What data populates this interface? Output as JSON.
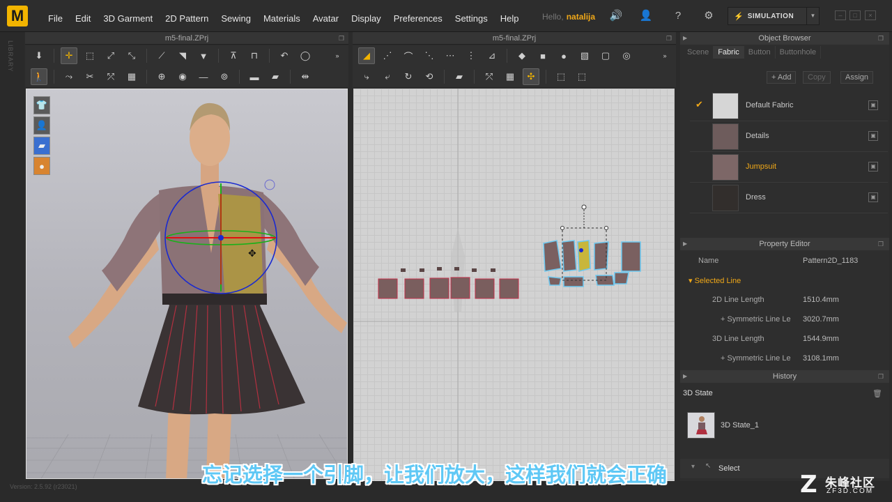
{
  "app": {
    "logo_letter": "M",
    "menus": [
      "File",
      "Edit",
      "3D Garment",
      "2D Pattern",
      "Sewing",
      "Materials",
      "Avatar",
      "Display",
      "Preferences",
      "Settings",
      "Help"
    ],
    "greeting": "Hello,",
    "username": "natalija",
    "simulation_label": "SIMULATION",
    "library_label": "LIBRARY",
    "accent_color": "#f0a818"
  },
  "view3d": {
    "title": "m5-final.ZPrj"
  },
  "view2d": {
    "title": "m5-final.ZPrj"
  },
  "object_browser": {
    "title": "Object Browser",
    "tabs": [
      "Scene",
      "Fabric",
      "Button",
      "Buttonhole"
    ],
    "selected_tab": "Fabric",
    "buttons": {
      "add": "+ Add",
      "copy": "Copy",
      "assign": "Assign"
    },
    "fabrics": [
      {
        "name": "Default Fabric",
        "color": "#d6d6d6",
        "checked": true
      },
      {
        "name": "Details",
        "color": "#6e5c5c",
        "checked": false
      },
      {
        "name": "Jumpsuit",
        "color": "#7d6767",
        "checked": false
      },
      {
        "name": "Dress",
        "color": "#322e2c",
        "checked": false
      }
    ]
  },
  "property_editor": {
    "title": "Property Editor",
    "name_label": "Name",
    "name_value": "Pattern2D_1183",
    "section": "Selected Line",
    "rows": [
      {
        "label": "2D Line Length",
        "value": "1510.4mm"
      },
      {
        "label": "+ Symmetric Line Le",
        "value": "3020.7mm"
      },
      {
        "label": "3D Line Length",
        "value": "1544.9mm"
      },
      {
        "label": "+ Symmetric Line Le",
        "value": "3108.1mm"
      }
    ]
  },
  "history": {
    "title": "History",
    "state_header": "3D State",
    "item": "3D State_1",
    "select_label": "Select"
  },
  "status": {
    "version": "Version: 2.5.92   (r23021)"
  },
  "subtitle": "忘记选择一个引脚，让我们放大，这样我们就会正确",
  "watermark": {
    "mark": "Z",
    "cn": "朱峰社区",
    "en": "ZF3D.COM"
  }
}
